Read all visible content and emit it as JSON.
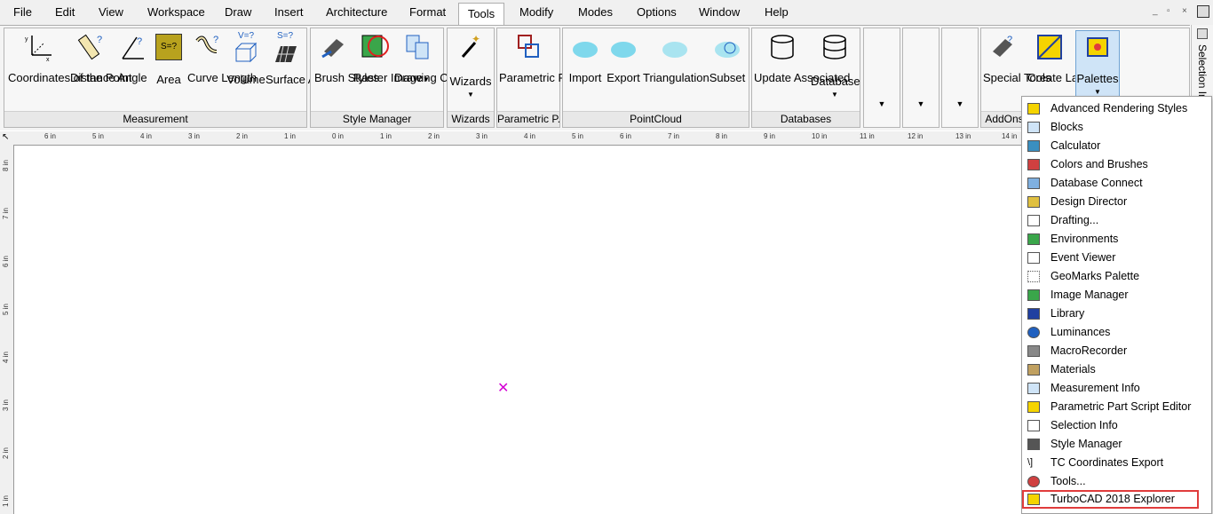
{
  "menubar": {
    "items": [
      "File",
      "Edit",
      "View",
      "Workspace",
      "Draw",
      "Insert",
      "Architecture",
      "Format",
      "Tools",
      "Modify",
      "Modes",
      "Options",
      "Window",
      "Help"
    ],
    "active": "Tools",
    "window_controls": [
      "_",
      "▫",
      "×"
    ]
  },
  "ribbon": {
    "groups": {
      "measurement": {
        "label": "Measurement",
        "tools": [
          "Coordinates of the Point",
          "Distance",
          "Angle",
          "Area",
          "Curve Length",
          "Volume",
          "Surface Area"
        ]
      },
      "style_manager": {
        "label": "Style Manager",
        "tools": [
          "Brush Styles",
          "Raster Image",
          "Drawing Compare"
        ]
      },
      "wizards": {
        "label": "Wizards",
        "tools": [
          "Wizards"
        ]
      },
      "parametric": {
        "label": "Parametric P...",
        "tools": [
          "Parametric Part"
        ]
      },
      "pointcloud": {
        "label": "PointCloud",
        "tools": [
          "Import",
          "Export",
          "Triangulation",
          "Subset"
        ]
      },
      "databases": {
        "label": "Databases",
        "tools": [
          "Update Associated",
          "Database"
        ]
      },
      "addons": {
        "label": "AddOns",
        "tools": [
          "Special Tools",
          "Create Layout",
          "Palettes"
        ]
      }
    },
    "icon_text": {
      "area": "S=?",
      "volume": "V=?",
      "surface": "S=?"
    }
  },
  "right_panel": {
    "label": "Selection In"
  },
  "ruler": {
    "h_labels": [
      "6 in",
      "5 in",
      "4 in",
      "3 in",
      "2 in",
      "1 in",
      "0 in",
      "1 in",
      "2 in",
      "3 in",
      "4 in",
      "5 in",
      "6 in",
      "7 in",
      "8 in",
      "9 in",
      "10 in",
      "11 in",
      "12 in",
      "13 in",
      "14 in"
    ],
    "v_labels": [
      "8 in",
      "7 in",
      "6 in",
      "5 in",
      "4 in",
      "3 in",
      "2 in",
      "1 in"
    ]
  },
  "dropdown": {
    "items": [
      "Advanced Rendering Styles",
      "Blocks",
      "Calculator",
      "Colors and Brushes",
      "Database Connect",
      "Design Director",
      "Drafting...",
      "Environments",
      "Event Viewer",
      "GeoMarks Palette",
      "Image Manager",
      "Library",
      "Luminances",
      "MacroRecorder",
      "Materials",
      "Measurement Info",
      "Parametric Part Script Editor",
      "Selection Info",
      "Style Manager",
      "TC Coordinates Export",
      "Tools...",
      "TurboCAD 2018 Explorer"
    ],
    "highlighted": "TurboCAD 2018 Explorer"
  },
  "colors": {
    "accent": "#e03c3c",
    "cursor": "#d400d4",
    "palettes_bg": "#cfe4f7"
  }
}
